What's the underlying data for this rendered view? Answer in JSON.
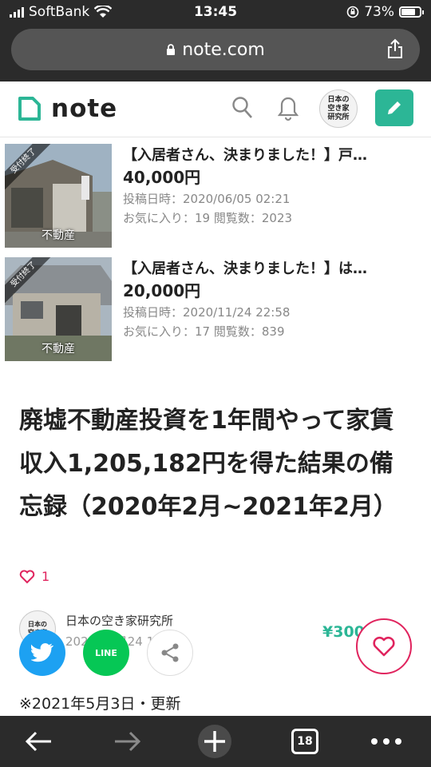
{
  "status_bar": {
    "carrier": "SoftBank",
    "time": "13:45",
    "battery": "73%"
  },
  "browser": {
    "url": "note.com",
    "tab_count": "18"
  },
  "header": {
    "logo": "note"
  },
  "profile": {
    "avatar_lines": [
      "日本の",
      "空き家",
      "研究所"
    ]
  },
  "listings": [
    {
      "thumb_caption": "不動産",
      "ribbon": "受付終了",
      "title": "【入居者さん、決まりました！】戸…",
      "price": "40,000円",
      "posted": "投稿日時：2020/06/05 02:21",
      "stats": "お気に入り：19 閲覧数：2023"
    },
    {
      "thumb_caption": "不動産",
      "ribbon": "受付終了",
      "title": "【入居者さん、決まりました！】は…",
      "price": "20,000円",
      "posted": "投稿日時：2020/11/24 22:58",
      "stats": "お気に入り：17 閲覧数：839"
    }
  ],
  "article": {
    "title": "廃墟不動産投資を1年間やって家賃収入1,205,182円を得た結果の備忘録（2020年2月~2021年2月）",
    "like_count": "1",
    "author": "日本の空き家研究所",
    "date": "2021年2月24 1",
    "price": "¥300",
    "updated": "※2021年5月3日・更新"
  },
  "share": {
    "line_label": "LINE"
  },
  "colors": {
    "accent": "#2cb696",
    "like": "#e0245e",
    "twitter": "#1da1f2",
    "line": "#06c755",
    "chrome": "#2b2b2b"
  }
}
